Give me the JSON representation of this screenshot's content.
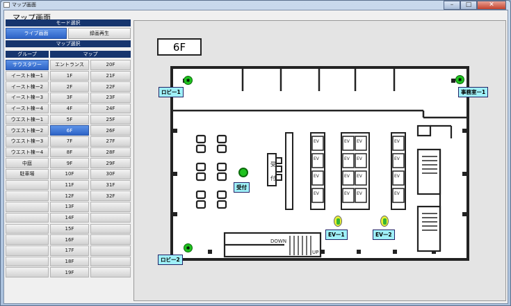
{
  "window": {
    "title": "マップ画面"
  },
  "screen_title": "マップ画面",
  "mode": {
    "header": "モード選択",
    "buttons": [
      {
        "label": "ライブ画面",
        "active": true
      },
      {
        "label": "録画再生",
        "active": false
      }
    ]
  },
  "map_select": {
    "header": "マップ選択",
    "group_header": "グループ",
    "map_header": "マップ",
    "groups": [
      "サウスタワー",
      "イースト棟ー1",
      "イースト棟ー2",
      "イースト棟ー3",
      "イースト棟ー4",
      "ウエスト棟ー1",
      "ウエスト棟ー2",
      "ウエスト棟ー3",
      "ウエスト棟ー4",
      "中庭",
      "駐車場"
    ],
    "active_group": "サウスタワー",
    "maps_col1": [
      "エントランス",
      "1F",
      "2F",
      "3F",
      "4F",
      "5F",
      "6F",
      "7F",
      "8F",
      "9F",
      "10F",
      "11F",
      "12F",
      "13F",
      "14F",
      "15F",
      "16F",
      "17F",
      "18F",
      "19F"
    ],
    "maps_col2": [
      "20F",
      "21F",
      "22F",
      "23F",
      "24F",
      "25F",
      "26F",
      "27F",
      "28F",
      "29F",
      "30F",
      "31F",
      "32F"
    ],
    "active_map": "6F"
  },
  "floor": {
    "name": "6F",
    "markers": {
      "lobby1": "ロビー1",
      "office1": "事務室ー1",
      "reception": "受付",
      "ev1": "EVー1",
      "ev2": "EVー2",
      "lobby2": "ロビー2"
    },
    "plan_text": {
      "reception_desk_1": "受",
      "reception_desk_2": "付",
      "ev": "EV",
      "stairs_down": "DOWN",
      "stairs_up": "UP"
    }
  },
  "colors": {
    "header_bg": "#16356e",
    "active_bg": "#2d63c6",
    "marker_label_bg": "#9ff0f8",
    "camera_green": "#1fc21f"
  }
}
